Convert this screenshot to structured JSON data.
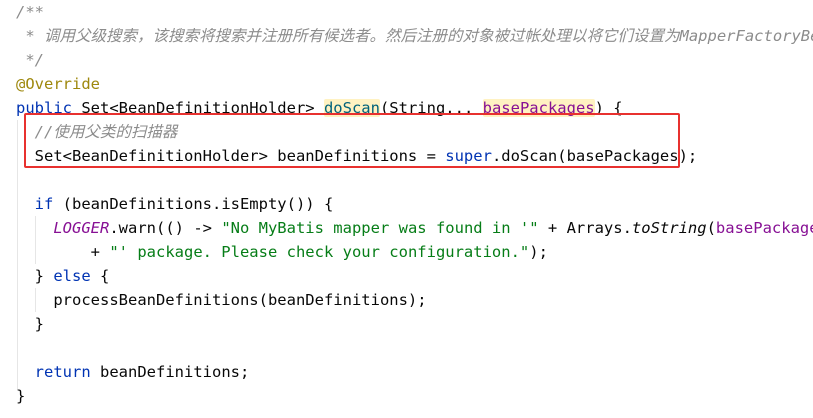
{
  "code": {
    "lines": [
      [
        {
          "t": "/**",
          "s": "comment"
        }
      ],
      [
        {
          "t": " * 调用父级搜索，该搜索将搜索并注册所有候选者。然后注册的对象被过帐处理以将它们设置为MapperFactoryBeans",
          "s": "comment"
        }
      ],
      [
        {
          "t": " */",
          "s": "comment"
        }
      ],
      [
        {
          "t": "@Override",
          "s": "annotation"
        }
      ],
      [
        {
          "t": "public ",
          "s": "keyword"
        },
        {
          "t": "Set<BeanDefinitionHolder> ",
          "s": "default"
        },
        {
          "t": "doScan",
          "s": "method-decl"
        },
        {
          "t": "(String... ",
          "s": "default"
        },
        {
          "t": "basePackages",
          "s": "param"
        },
        {
          "t": ") {",
          "s": "default"
        }
      ],
      [
        {
          "t": "  //使用父类的扫描器",
          "s": "comment"
        }
      ],
      [
        {
          "t": "  Set<BeanDefinitionHolder> beanDefinitions = ",
          "s": "default"
        },
        {
          "t": "super",
          "s": "keyword"
        },
        {
          "t": ".doScan(basePackages);",
          "s": "default"
        }
      ],
      [
        {
          "t": "",
          "s": "default"
        }
      ],
      [
        {
          "t": "  ",
          "s": "default"
        },
        {
          "t": "if",
          "s": "keyword"
        },
        {
          "t": " (beanDefinitions.isEmpty()) {",
          "s": "default"
        }
      ],
      [
        {
          "t": "    ",
          "s": "default"
        },
        {
          "t": "LOGGER",
          "s": "static-field"
        },
        {
          "t": ".warn(() -> ",
          "s": "default"
        },
        {
          "t": "\"No MyBatis mapper was found in '\"",
          "s": "string"
        },
        {
          "t": " + Arrays.",
          "s": "default"
        },
        {
          "t": "toString",
          "s": "static-method"
        },
        {
          "t": "(",
          "s": "default"
        },
        {
          "t": "basePackages",
          "s": "param-plain"
        },
        {
          "t": ")",
          "s": "default"
        }
      ],
      [
        {
          "t": "        + ",
          "s": "default"
        },
        {
          "t": "\"' package. Please check your configuration.\"",
          "s": "string"
        },
        {
          "t": ");",
          "s": "default"
        }
      ],
      [
        {
          "t": "  } ",
          "s": "default"
        },
        {
          "t": "else",
          "s": "keyword"
        },
        {
          "t": " {",
          "s": "default"
        }
      ],
      [
        {
          "t": "    processBeanDefinitions(beanDefinitions);",
          "s": "default"
        }
      ],
      [
        {
          "t": "  }",
          "s": "default"
        }
      ],
      [
        {
          "t": "",
          "s": "default"
        }
      ],
      [
        {
          "t": "  ",
          "s": "default"
        },
        {
          "t": "return",
          "s": "keyword"
        },
        {
          "t": " beanDefinitions;",
          "s": "default"
        }
      ],
      [
        {
          "t": "}",
          "s": "default"
        }
      ]
    ]
  },
  "highlight": {
    "color": "#e8312f"
  }
}
